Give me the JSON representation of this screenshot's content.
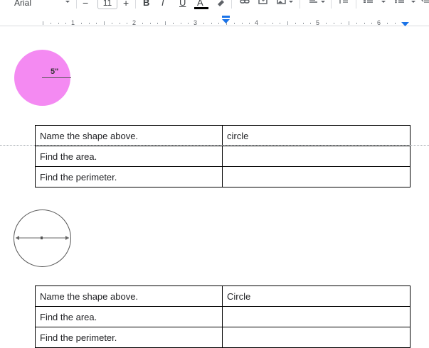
{
  "toolbar": {
    "font_name": "Arial",
    "font_size": "11",
    "minus_label": "−",
    "plus_label": "+",
    "bold_label": "B",
    "italic_label": "I",
    "underline_label": "U",
    "text_color_label": "A"
  },
  "ruler": {
    "numbers": [
      "1",
      "2",
      "3",
      "4",
      "5",
      "6"
    ]
  },
  "document": {
    "shape1": {
      "radius_label": "5\"",
      "fill_color": "#f48af2"
    },
    "table1": {
      "rows": [
        {
          "question": "Name the shape above.",
          "answer": "circle"
        },
        {
          "question": "Find the area.",
          "answer": ""
        },
        {
          "question": "Find the perimeter.",
          "answer": ""
        }
      ]
    },
    "table2": {
      "rows": [
        {
          "question": "Name the shape above.",
          "answer": "Circle"
        },
        {
          "question": "Find the area.",
          "answer": ""
        },
        {
          "question": "Find the perimeter.",
          "answer": ""
        }
      ]
    }
  }
}
